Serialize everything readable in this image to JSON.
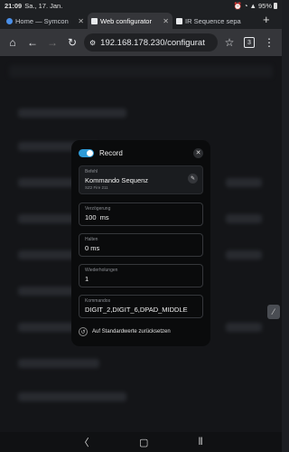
{
  "status_bar": {
    "time": "21:09",
    "date": "Sa., 17. Jan.",
    "battery": "95%"
  },
  "tabs": [
    {
      "label": "Home — Symcon",
      "favicon_color": "#4a8fe8",
      "active": false
    },
    {
      "label": "Web configurator",
      "favicon_color": "#e8eaed",
      "active": true
    },
    {
      "label": "IR Sequence sepa",
      "favicon_color": "#e8eaed",
      "active": false
    }
  ],
  "toolbar": {
    "url": "192.168.178.230/configurat",
    "tab_count": "3"
  },
  "modal": {
    "title": "Record",
    "befehl": {
      "label": "Befehl",
      "value": "Kommando Sequenz",
      "sub": "SZ2 Fire 211"
    },
    "fields": [
      {
        "label": "Verzögerung",
        "value": "100  ms"
      },
      {
        "label": "Halten",
        "value": "0 ms"
      },
      {
        "label": "Wiederholungen",
        "value": "1"
      },
      {
        "label": "Kommandos",
        "value": "DIGIT_2,DIGIT_6,DPAD_MIDDLE"
      }
    ],
    "reset_label": "Auf Standardwerte zurücksetzen"
  },
  "colors": {
    "accent": "#2e9ad6",
    "modal_bg": "#0a0b0c"
  }
}
